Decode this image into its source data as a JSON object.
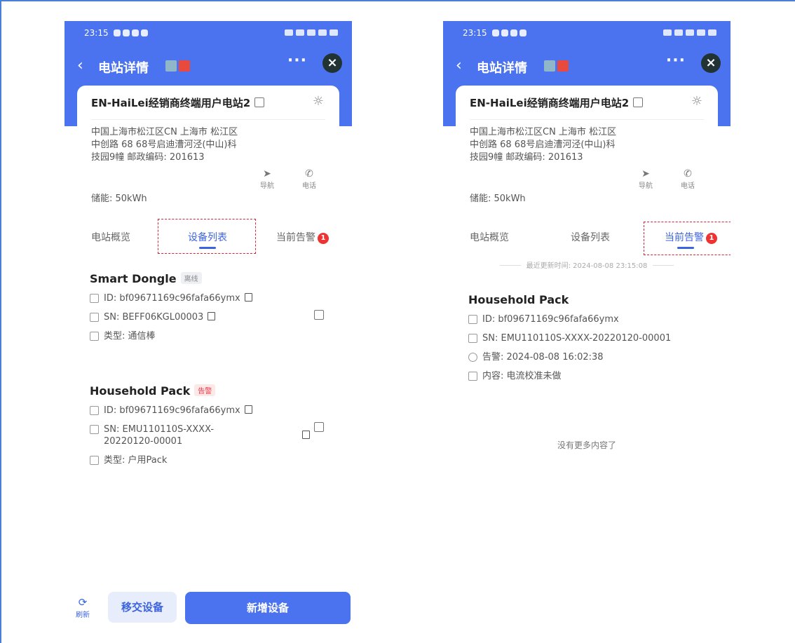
{
  "left": {
    "status_time": "23:15",
    "title": "电站详情",
    "station_name": "EN-HaiLei经销商终端用户电站2",
    "address": "中国上海市松江区CN 上海市 松江区 中创路 68 68号启迪漕河泾(中山)科技园9幢 邮政编码: 201613",
    "nav_label": "导航",
    "call_label": "电话",
    "storage": "储能: 50kWh",
    "tabs": [
      {
        "label": "电站概览"
      },
      {
        "label": "设备列表"
      },
      {
        "label": "当前告警"
      }
    ],
    "badge_count": "1",
    "devices": [
      {
        "name": "Smart Dongle",
        "status": "离线",
        "id": "ID: bf09671169c96fafa66ymx",
        "sn": "SN: BEFF06KGL00003",
        "type": "类型: 通信棒"
      },
      {
        "name": "Household Pack",
        "status": "告警",
        "id": "ID: bf09671169c96fafa66ymx",
        "sn": "SN: EMU110110S-XXXX-20220120-00001",
        "type": "类型: 户用Pack"
      }
    ],
    "footer": {
      "refresh": "刷新",
      "transfer": "移交设备",
      "add": "新增设备"
    }
  },
  "right": {
    "status_time": "23:15",
    "title": "电站详情",
    "station_name": "EN-HaiLei经销商终端用户电站2",
    "address": "中国上海市松江区CN 上海市 松江区 中创路 68 68号启迪漕河泾(中山)科技园9幢 邮政编码: 201613",
    "nav_label": "导航",
    "call_label": "电话",
    "storage": "储能: 50kWh",
    "tabs": [
      {
        "label": "电站概览"
      },
      {
        "label": "设备列表"
      },
      {
        "label": "当前告警"
      }
    ],
    "badge_count": "1",
    "updated": "最近更新时间: 2024-08-08 23:15:08",
    "alarm": {
      "name": "Household Pack",
      "id": "ID: bf09671169c96fafa66ymx",
      "sn": "SN: EMU110110S-XXXX-20220120-00001",
      "time": "告警: 2024-08-08 16:02:38",
      "content": "内容: 电流校准未做"
    },
    "no_more": "没有更多内容了"
  }
}
